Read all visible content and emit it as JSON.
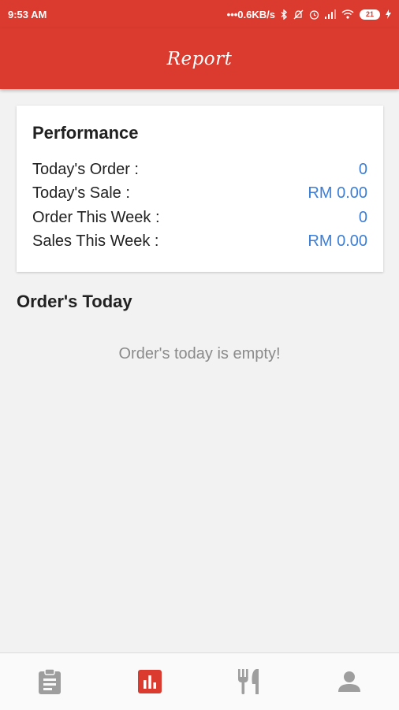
{
  "status_bar": {
    "time": "9:53 AM",
    "network_speed": "0.6KB/s",
    "battery_level": "21",
    "icons": [
      "bluetooth-icon",
      "mute-icon",
      "alarm-icon",
      "signal-icon",
      "wifi-icon",
      "battery-icon",
      "charging-icon"
    ]
  },
  "app_bar": {
    "title": "Report"
  },
  "performance": {
    "title": "Performance",
    "rows": [
      {
        "label": "Today's Order :",
        "value": "0"
      },
      {
        "label": "Today's Sale :",
        "value": "RM 0.00"
      },
      {
        "label": "Order This Week :",
        "value": "0"
      },
      {
        "label": "Sales This Week :",
        "value": "RM 0.00"
      }
    ]
  },
  "orders_today": {
    "title": "Order's Today",
    "empty_message": "Order's today is empty!"
  },
  "bottom_nav": {
    "items": [
      {
        "icon": "clipboard-icon",
        "active": false
      },
      {
        "icon": "bar-chart-icon",
        "active": true
      },
      {
        "icon": "fork-knife-icon",
        "active": false
      },
      {
        "icon": "person-icon",
        "active": false
      }
    ]
  },
  "colors": {
    "primary": "#db3b2f",
    "value_text": "#3b7ed8",
    "nav_inactive": "#9e9e9e",
    "background": "#f2f2f2"
  }
}
